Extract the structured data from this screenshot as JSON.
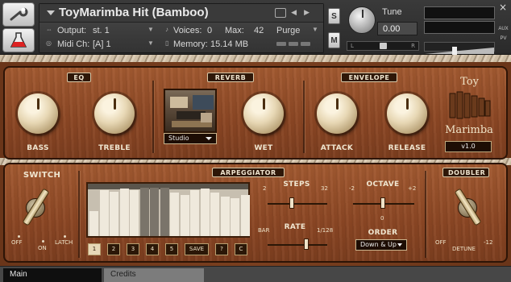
{
  "header": {
    "instrument_name": "ToyMarimba Hit (Bamboo)",
    "output_label": "Output:",
    "output_value": "st. 1",
    "voices_label": "Voices:",
    "voices_value": "0",
    "max_label": "Max:",
    "max_value": "42",
    "purge_label": "Purge",
    "midi_label": "Midi Ch:",
    "midi_value": "[A]  1",
    "memory_label": "Memory:",
    "memory_value": "15.14 MB",
    "solo_label": "S",
    "mute_label": "M",
    "tune_label": "Tune",
    "tune_value": "0.00",
    "pan_left": "L",
    "pan_right": "R",
    "aux_label": "AUX",
    "pv_label": "PV",
    "close_symbol": "×",
    "icons": [
      "wrench-icon",
      "flask-icon",
      "camera-icon",
      "info-icon",
      "midi-icon",
      "memory-icon"
    ]
  },
  "top_panel": {
    "eq_label": "EQ",
    "reverb_label": "REVERB",
    "envelope_label": "ENVELOPE",
    "knobs": {
      "bass": "BASS",
      "treble": "TREBLE",
      "wet": "WET",
      "attack": "ATTACK",
      "release": "RELEASE"
    },
    "reverb_preset": "Studio",
    "brand_line1": "Toy",
    "brand_line2": "Marimba",
    "version": "v1.0"
  },
  "bottom_panel": {
    "switch_label": "SWITCH",
    "switch_off": "OFF",
    "switch_on": "ON",
    "switch_latch": "LATCH",
    "arp_label": "ARPEGGIATOR",
    "steps_label": "STEPS",
    "steps_min": "2",
    "steps_max": "32",
    "rate_label": "RATE",
    "rate_min": "BAR",
    "rate_max": "1/128",
    "octave_label": "OCTAVE",
    "octave_min": "-2",
    "octave_max": "+2",
    "octave_center": "0",
    "order_label": "ORDER",
    "order_value": "Down & Up",
    "doubler_label": "DOUBLER",
    "doubler_off": "OFF",
    "doubler_detune": "DETUNE",
    "doubler_max": "-12",
    "pattern_buttons": [
      "1",
      "2",
      "3",
      "4",
      "5",
      "SAVE",
      "?",
      "C"
    ],
    "arp_steps": [
      0.52,
      0.95,
      0.92,
      0.98,
      0.95,
      0.0,
      0.0,
      0.0,
      0.9,
      0.85,
      0.95,
      0.98,
      0.9,
      0.82,
      0.78,
      0.85
    ]
  },
  "tabs": {
    "main": "Main",
    "credits": "Credits"
  },
  "colors": {
    "wood": "#8c4724",
    "label_bg": "#2e1708",
    "knob_cream": "#e7d7b4"
  }
}
